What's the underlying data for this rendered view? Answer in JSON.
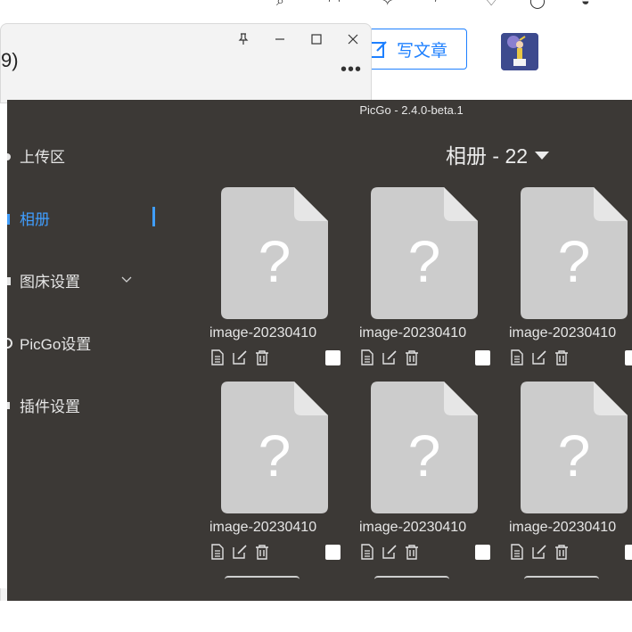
{
  "browser": {
    "write_article_label": "写文章"
  },
  "back_window": {
    "title_fragment": "9)",
    "more_label": "•••"
  },
  "picgo": {
    "title": "PicGo - 2.4.0-beta.1",
    "nav": [
      {
        "label": "上传区"
      },
      {
        "label": "相册"
      },
      {
        "label": "图床设置"
      },
      {
        "label": "PicGo设置"
      },
      {
        "label": "插件设置"
      }
    ],
    "album_header": "相册 - 22",
    "placeholder_glyph": "?",
    "images": [
      {
        "name": "image-20230410"
      },
      {
        "name": "image-20230410"
      },
      {
        "name": "image-20230410"
      },
      {
        "name": "image-20230410"
      },
      {
        "name": "image-20230410"
      },
      {
        "name": "image-20230410"
      }
    ]
  },
  "colors": {
    "accent": "#409eff",
    "panel_bg": "#3c3936",
    "file_icon": "#cccccc",
    "link_blue": "#1e80ff"
  }
}
